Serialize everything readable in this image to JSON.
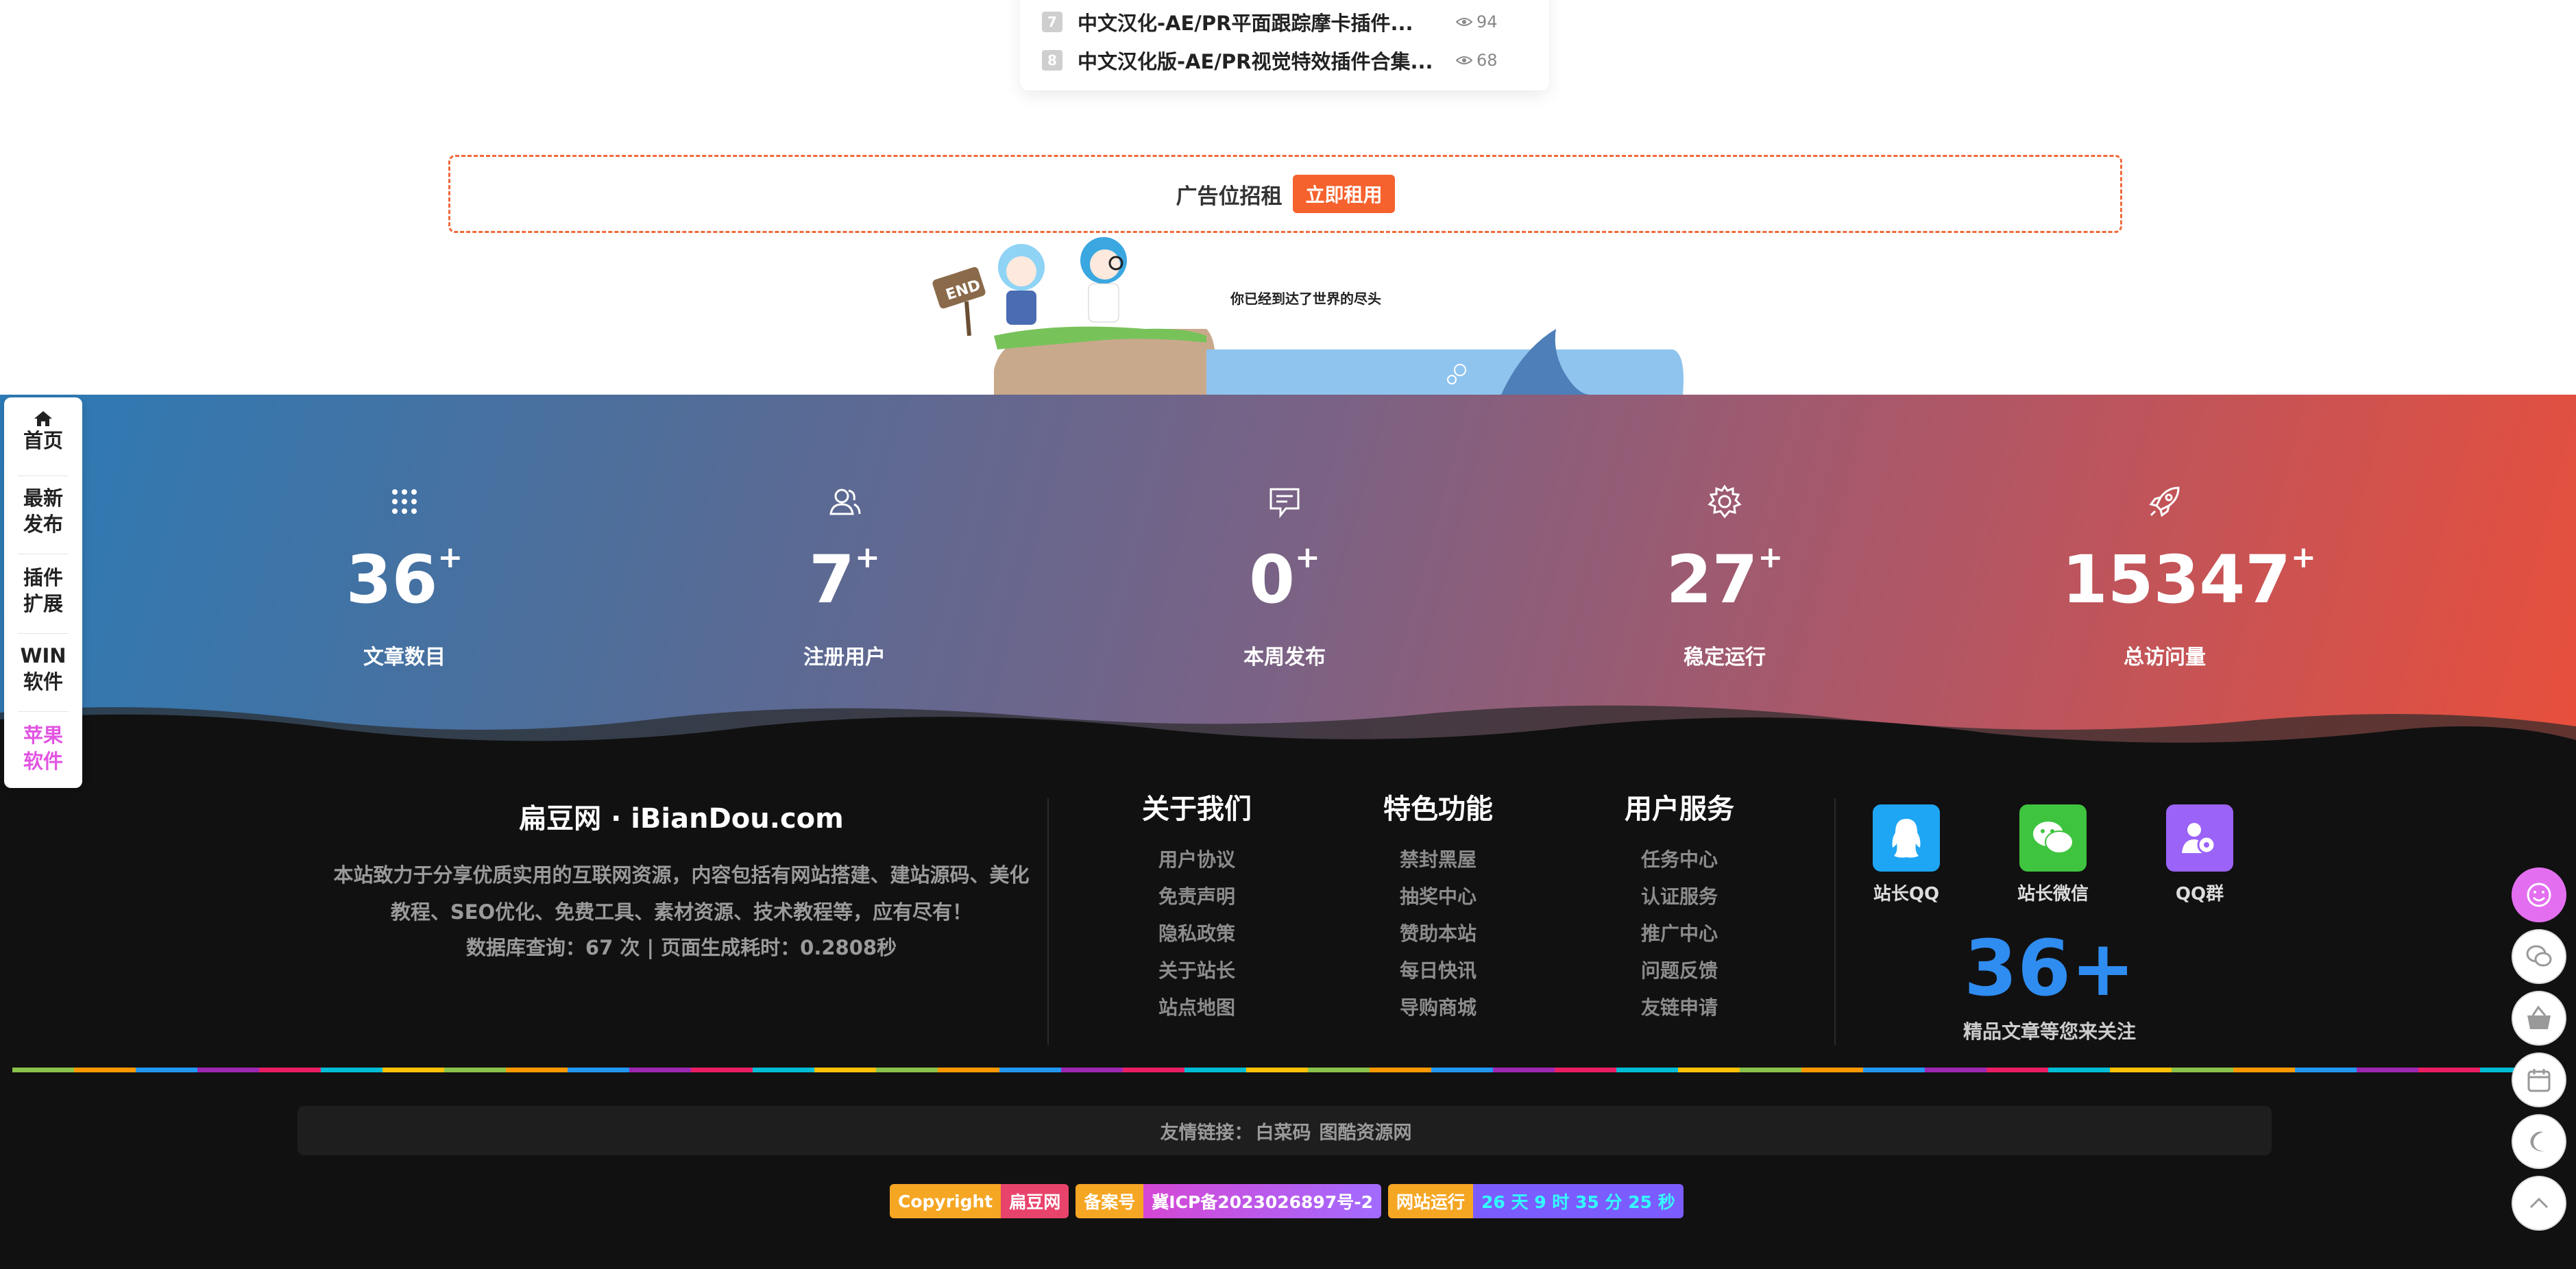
{
  "ranking": {
    "items": [
      {
        "num": "7",
        "title": "中文汉化-AE/PR平面跟踪摩卡插件...",
        "views": "94"
      },
      {
        "num": "8",
        "title": "中文汉化版-AE/PR视觉特效插件合集...",
        "views": "68"
      }
    ]
  },
  "ad": {
    "text": "广告位招租",
    "button": "立即租用"
  },
  "end": {
    "text": "你已经到达了世界的尽头",
    "sign": "END"
  },
  "stats": [
    {
      "icon": "grid-dots-icon",
      "value": "36",
      "plus": "+",
      "label": "文章数目"
    },
    {
      "icon": "users-icon",
      "value": "7",
      "plus": "+",
      "label": "注册用户"
    },
    {
      "icon": "message-icon",
      "value": "0",
      "plus": "+",
      "label": "本周发布"
    },
    {
      "icon": "gear-icon",
      "value": "27",
      "plus": "+",
      "label": "稳定运行"
    },
    {
      "icon": "rocket-icon",
      "value": "15347",
      "plus": "+",
      "label": "总访问量"
    }
  ],
  "footer": {
    "site_title": "扁豆网 · iBianDou.com",
    "description": "本站致力于分享优质实用的互联网资源，内容包括有网站搭建、建站源码、美化教程、SEO优化、免费工具、素材资源、技术教程等，应有尽有！",
    "db_stat": "数据库查询：67 次 | 页面生成耗时：0.2808秒",
    "columns": [
      {
        "title": "关于我们",
        "links": [
          "用户协议",
          "免责声明",
          "隐私政策",
          "关于站长",
          "站点地图"
        ]
      },
      {
        "title": "特色功能",
        "links": [
          "禁封黑屋",
          "抽奖中心",
          "赞助本站",
          "每日快讯",
          "导购商城"
        ]
      },
      {
        "title": "用户服务",
        "links": [
          "任务中心",
          "认证服务",
          "推广中心",
          "问题反馈",
          "友链申请"
        ]
      }
    ],
    "social": [
      {
        "icon": "qq-icon",
        "label": "站长QQ",
        "color": "#1ea5f4"
      },
      {
        "icon": "wechat-icon",
        "label": "站长微信",
        "color": "#3fc43f"
      },
      {
        "icon": "group-icon",
        "label": "QQ群",
        "color": "#9b63f7"
      }
    ],
    "big_count": "36+",
    "big_count_label": "精品文章等您来关注",
    "friend_links": {
      "label": "友情链接：",
      "items": [
        "白菜码",
        "图酷资源网"
      ]
    },
    "badges": {
      "copyright_label": "Copyright",
      "copyright_value": "扁豆网",
      "icp_label": "备案号",
      "icp_value": "冀ICP备2023026897号-2",
      "uptime_label": "网站运行",
      "uptime_value": "26 天 9 时 35 分 25 秒"
    }
  },
  "leftnav": {
    "items": [
      {
        "line1": "首页",
        "line2": ""
      },
      {
        "line1": "最新",
        "line2": "发布"
      },
      {
        "line1": "插件",
        "line2": "扩展"
      },
      {
        "line1": "WIN",
        "line2": "软件"
      },
      {
        "line1": "苹果",
        "line2": "软件"
      }
    ],
    "active_color": "#e255e2"
  },
  "right_buttons": [
    "smile-icon",
    "chat-icon",
    "basket-icon",
    "calendar-icon",
    "moon-icon",
    "chevron-up-icon"
  ],
  "colors": {
    "accent": "#f5622d",
    "count_blue": "#2f8cf0",
    "footer_bg": "#111111"
  }
}
